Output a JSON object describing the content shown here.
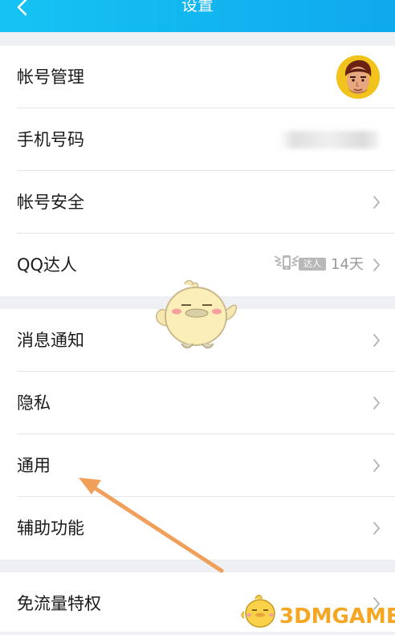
{
  "header": {
    "title": "设置",
    "back_icon": "chevron-left-icon"
  },
  "group1": {
    "items": [
      {
        "label": "帐号管理",
        "right": "avatar"
      },
      {
        "label": "手机号码",
        "right": "blurred-phone-number"
      },
      {
        "label": "帐号安全",
        "right": "chevron-right-icon"
      },
      {
        "label": "QQ达人",
        "badge": "达人",
        "days": "14天",
        "right": "chevron-right-icon"
      }
    ]
  },
  "group2": {
    "items": [
      {
        "label": "消息通知"
      },
      {
        "label": "隐私"
      },
      {
        "label": "通用"
      },
      {
        "label": "辅助功能"
      }
    ]
  },
  "group3": {
    "items": [
      {
        "label": "免流量特权"
      }
    ]
  },
  "overlay": {
    "arrow_color": "#f0a05a",
    "watermark": "3DMGAME",
    "watermark_color": "#f5a623",
    "mascot": "yellow-bird-mascot"
  },
  "colors": {
    "header_gradient_start": "#16c3f4",
    "header_gradient_end": "#0fa9ee",
    "background": "#eff0f4"
  }
}
